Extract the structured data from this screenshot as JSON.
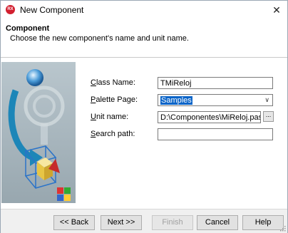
{
  "window": {
    "title": "New Component",
    "icon_text": "RX",
    "close_glyph": "✕"
  },
  "header": {
    "title": "Component",
    "subtitle": "Choose the new component's name and unit name."
  },
  "form": {
    "class_name": {
      "label_ul": "C",
      "label_rest": "lass Name:",
      "value": "TMiReloj"
    },
    "palette_page": {
      "label_ul": "P",
      "label_rest": "alette Page:",
      "value": "Samples"
    },
    "unit_name": {
      "label_ul": "U",
      "label_rest": "nit name:",
      "value": "D:\\Componentes\\MiReloj.pas",
      "browse": "..."
    },
    "search_path": {
      "label_ul": "S",
      "label_rest": "earch path:",
      "value": ""
    }
  },
  "buttons": {
    "back": "<< Back",
    "next": "Next >>",
    "finish": "Finish",
    "cancel": "Cancel",
    "help": "Help"
  },
  "colors": {
    "accent": "#0a64c8",
    "brand": "#d21f2f"
  }
}
